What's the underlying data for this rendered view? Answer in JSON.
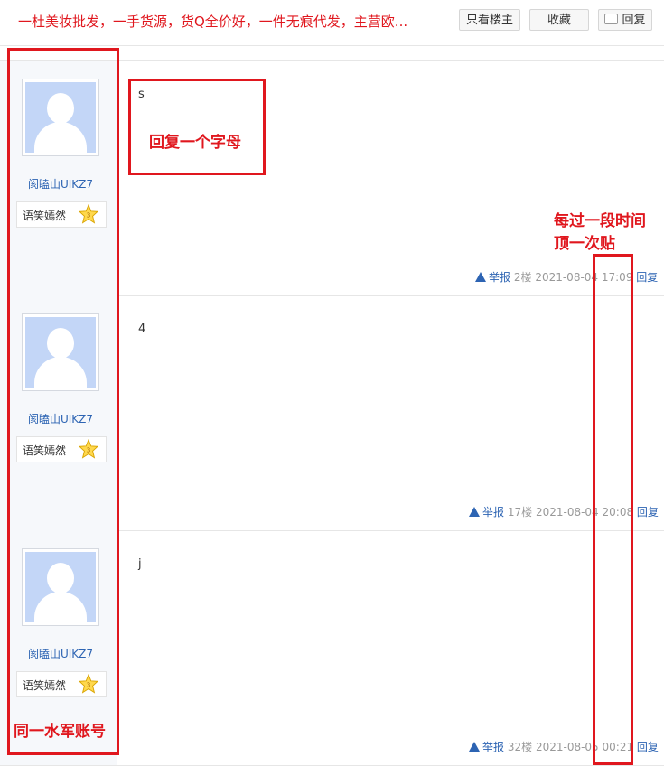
{
  "header": {
    "title": "一杜美妆批发，一手货源，货Q全价好，一件无痕代发，主营欧...",
    "only_owner": "只看楼主",
    "favorite": "收藏",
    "reply": "回复"
  },
  "posts": [
    {
      "user": "阂瞌山UIKZ7",
      "tag": "语笑嫣然",
      "level": "3",
      "content": "s",
      "report": "举报",
      "floor": "2楼",
      "time": "2021-08-04 17:09",
      "reply": "回复"
    },
    {
      "user": "阂瞌山UIKZ7",
      "tag": "语笑嫣然",
      "level": "3",
      "content": "4",
      "report": "举报",
      "floor": "17楼",
      "time": "2021-08-04 20:08",
      "reply": "回复"
    },
    {
      "user": "阂瞌山UIKZ7",
      "tag": "语笑嫣然",
      "level": "3",
      "content": "j",
      "report": "举报",
      "floor": "32楼",
      "time": "2021-08-05 00:21",
      "reply": "回复"
    }
  ],
  "annotations": {
    "reply_letter": "回复一个字母",
    "bump_line1": "每过一段时间",
    "bump_line2": "顶一次贴",
    "same_account": "同一水军账号",
    "color": "#e0171e"
  }
}
